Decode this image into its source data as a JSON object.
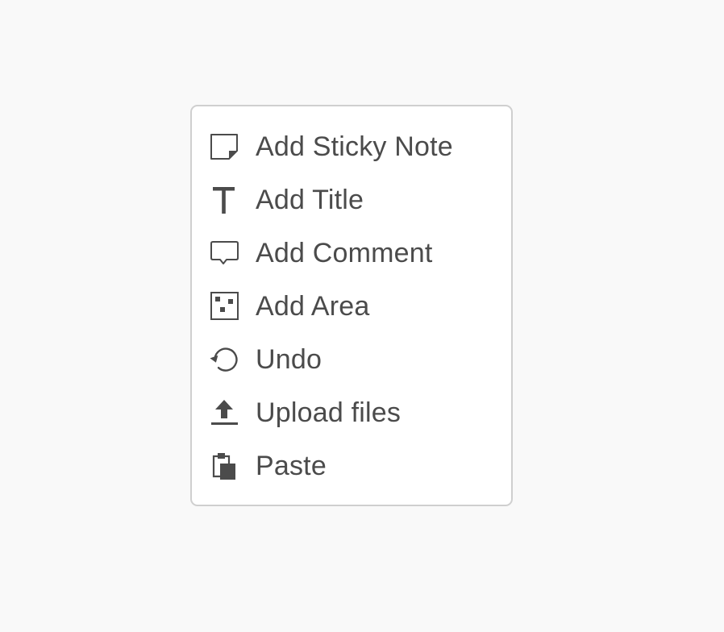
{
  "colors": {
    "background": "#f9f9f9",
    "menu_background": "#ffffff",
    "menu_border": "#cfcfcf",
    "text": "#4b4b4b",
    "icon": "#4b4b4b"
  },
  "context_menu": {
    "items": [
      {
        "label": "Add Sticky Note",
        "icon": "sticky-note-icon"
      },
      {
        "label": "Add Title",
        "icon": "title-text-icon"
      },
      {
        "label": "Add Comment",
        "icon": "comment-bubble-icon"
      },
      {
        "label": "Add Area",
        "icon": "area-grid-icon"
      },
      {
        "label": "Undo",
        "icon": "undo-arrow-icon"
      },
      {
        "label": "Upload files",
        "icon": "upload-arrow-icon"
      },
      {
        "label": "Paste",
        "icon": "paste-clipboard-icon"
      }
    ]
  }
}
